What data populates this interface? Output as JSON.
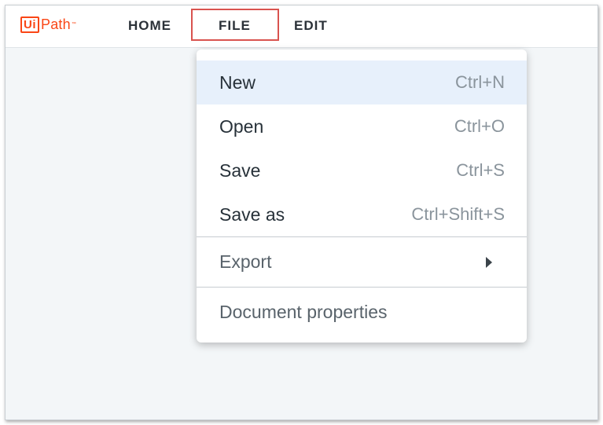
{
  "brand": {
    "box_text": "Ui",
    "text": "Path",
    "tm": "™",
    "color": "#fa4616"
  },
  "nav": {
    "items": [
      {
        "label": "HOME"
      },
      {
        "label": "FILE"
      },
      {
        "label": "EDIT"
      }
    ],
    "highlight_color": "#d9534f"
  },
  "file_menu": {
    "items": [
      {
        "label": "New",
        "shortcut": "Ctrl+N",
        "hovered": true
      },
      {
        "label": "Open",
        "shortcut": "Ctrl+O"
      },
      {
        "label": "Save",
        "shortcut": "Ctrl+S"
      },
      {
        "label": "Save as",
        "shortcut": "Ctrl+Shift+S"
      },
      {
        "label": "Export",
        "submenu_icon": "chevron-right-icon"
      },
      {
        "label": "Document properties"
      }
    ],
    "hover_color": "#e7f0fb"
  }
}
